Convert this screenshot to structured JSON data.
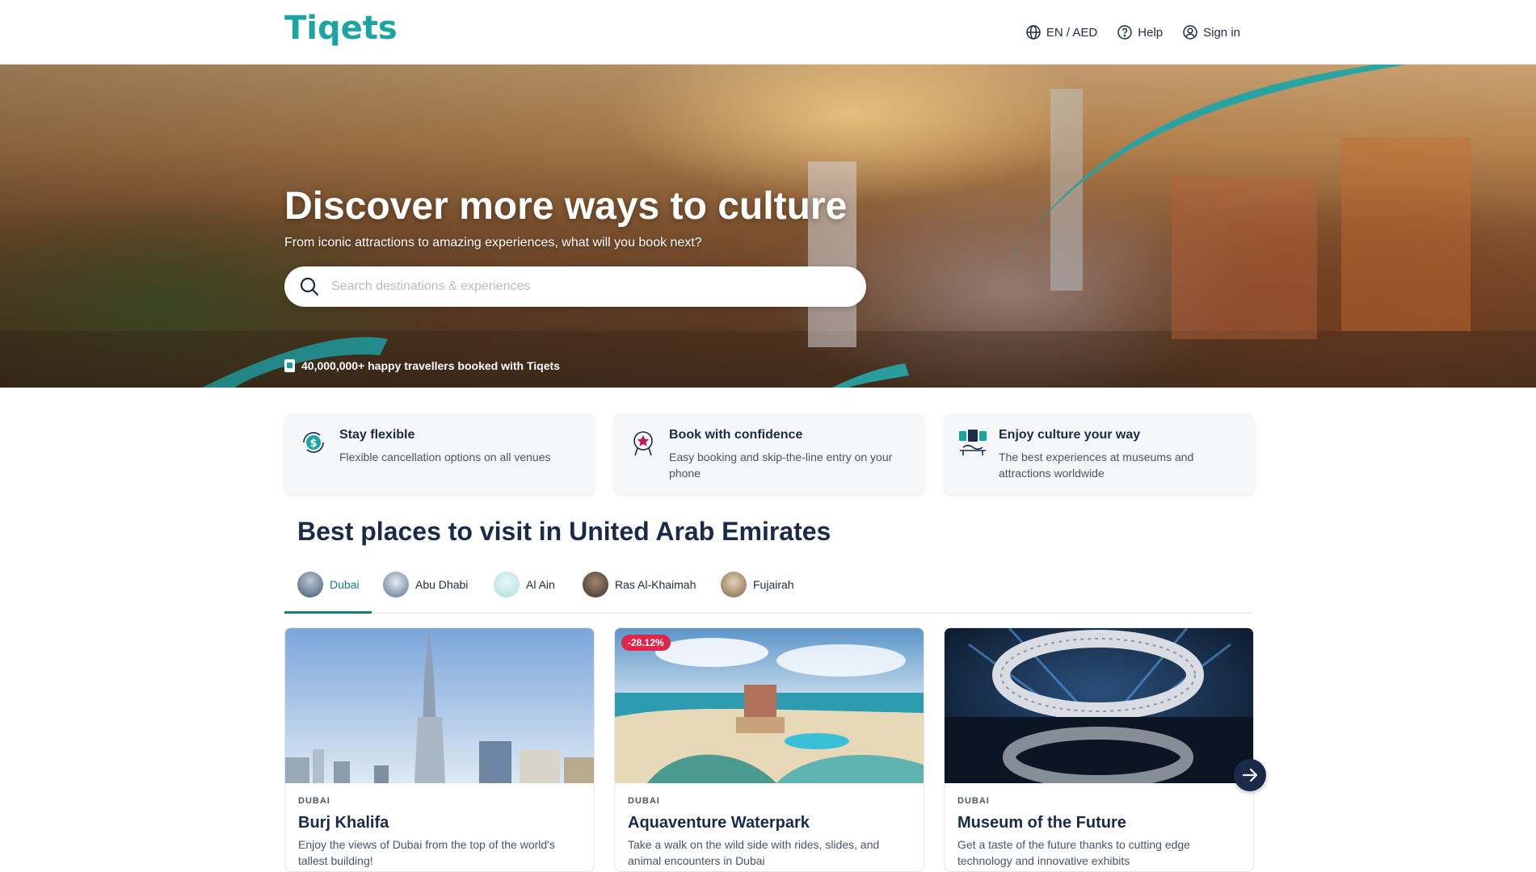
{
  "header": {
    "logo": "Tiqets",
    "lang_currency": "EN / AED",
    "help": "Help",
    "sign_in": "Sign in"
  },
  "hero": {
    "title": "Discover more ways to culture",
    "subtitle": "From iconic attractions to amazing experiences, what will you book next?",
    "search_placeholder": "Search destinations & experiences",
    "happy_travellers": "40,000,000+ happy travellers booked with Tiqets"
  },
  "usps": [
    {
      "title": "Stay flexible",
      "text": "Flexible cancellation options on all venues",
      "icon": "cancellation-money-icon"
    },
    {
      "title": "Book with confidence",
      "text": "Easy booking and skip-the-line entry on your phone",
      "icon": "star-award-icon"
    },
    {
      "title": "Enjoy culture your way",
      "text": "The best experiences at museums and attractions worldwide",
      "icon": "museum-gallery-icon"
    }
  ],
  "section": {
    "title": "Best places to visit in United Arab Emirates",
    "tabs": [
      {
        "label": "Dubai",
        "active": true
      },
      {
        "label": "Abu Dhabi",
        "active": false
      },
      {
        "label": "Al Ain",
        "active": false
      },
      {
        "label": "Ras Al-Khaimah",
        "active": false
      },
      {
        "label": "Fujairah",
        "active": false
      }
    ]
  },
  "cards": [
    {
      "location": "DUBAI",
      "title": "Burj Khalifa",
      "description": "Enjoy the views of Dubai from the top of the world's tallest building!",
      "discount": ""
    },
    {
      "location": "DUBAI",
      "title": "Aquaventure Waterpark",
      "description": "Take a walk on the wild side with rides, slides, and animal encounters in Dubai",
      "discount": "-28.12%"
    },
    {
      "location": "DUBAI",
      "title": "Museum of the Future",
      "description": "Get a taste of the future thanks to cutting edge technology and innovative exhibits",
      "discount": ""
    }
  ],
  "colors": {
    "brand": "#1aa5a2",
    "navy": "#1a2b49",
    "tab_active": "#147c7a",
    "discount": "#e0264a"
  }
}
